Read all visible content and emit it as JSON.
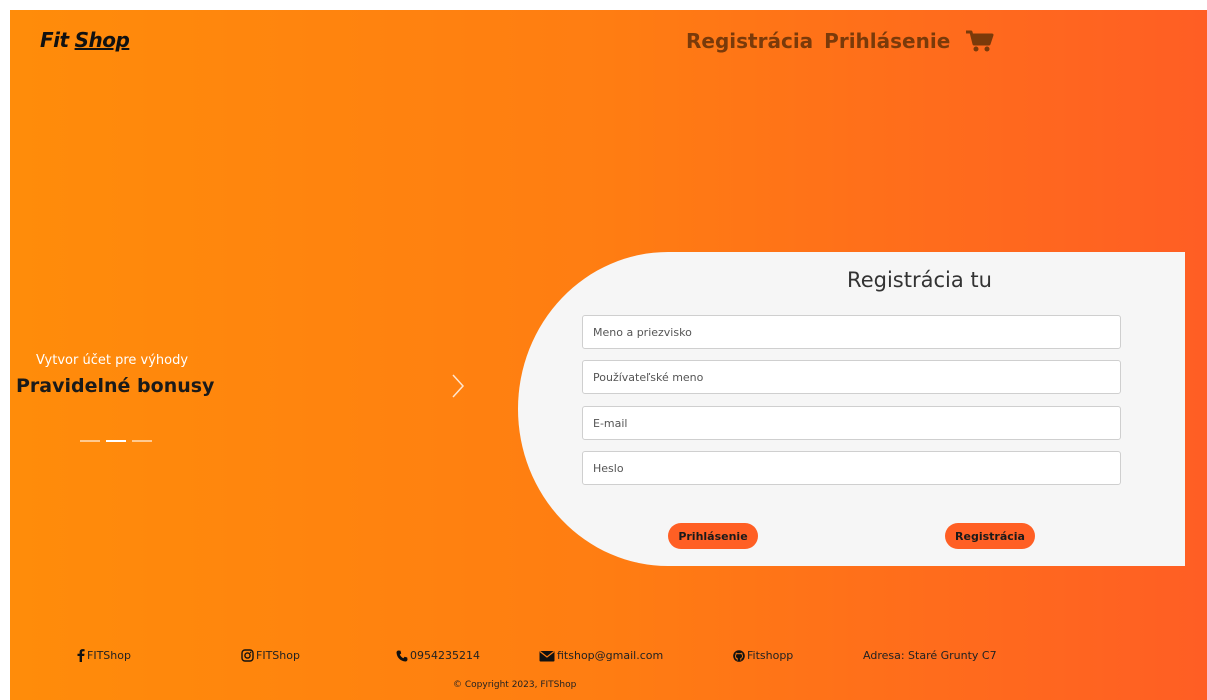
{
  "header": {
    "logo_part1": "Fit",
    "logo_part2": "Shop",
    "nav_register": "Registrácia",
    "nav_login": "Prihlásenie",
    "cart_icon": "shopping-cart-icon"
  },
  "carousel": {
    "subtitle": "Vytvor účet pre výhody",
    "title": "Pravidelné bonusy",
    "next_icon": "chevron-right-icon",
    "active_slide": 2,
    "slide_count": 3
  },
  "form": {
    "title": "Registrácia tu",
    "name_placeholder": "Meno a priezvisko",
    "username_placeholder": "Používateľské meno",
    "email_placeholder": "E-mail",
    "password_placeholder": "Heslo",
    "login_button": "Prihlásenie",
    "register_button": "Registrácia"
  },
  "footer": {
    "facebook": "FITShop",
    "instagram": "FITShop",
    "phone": "0954235214",
    "email": "fitshop@gmail.com",
    "github": "Fitshopp",
    "address": "Adresa: Staré Grunty C7",
    "copyright": "© Copyright 2023, FITShop"
  },
  "colors": {
    "gradient_start": "#ff8c0a",
    "gradient_end": "#ff5e24",
    "button": "#ff5f24",
    "nav_text": "#7a3a0a",
    "card": "#f6f6f6"
  }
}
